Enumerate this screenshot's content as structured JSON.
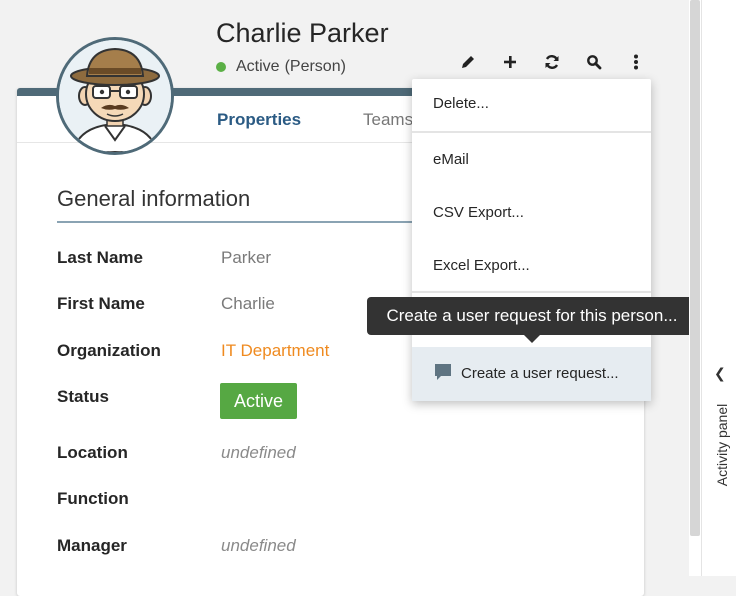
{
  "person": {
    "name": "Charlie Parker",
    "status": "Active",
    "class": "(Person)"
  },
  "toolbar": {
    "icons": [
      "pencil-icon",
      "plus-icon",
      "refresh-icon",
      "search-icon",
      "more-vertical-icon"
    ]
  },
  "tabs": [
    {
      "label": "Properties"
    },
    {
      "label": "Teams"
    }
  ],
  "section": {
    "title": "General information"
  },
  "fields": {
    "last_name": {
      "label": "Last Name",
      "value": "Parker"
    },
    "first_name": {
      "label": "First Name",
      "value": "Charlie"
    },
    "organization": {
      "label": "Organization",
      "value": "IT Department"
    },
    "status": {
      "label": "Status",
      "value": "Active"
    },
    "location": {
      "label": "Location",
      "value": "undefined"
    },
    "function": {
      "label": "Function",
      "value": ""
    },
    "manager": {
      "label": "Manager",
      "value": "undefined"
    }
  },
  "menu": {
    "delete": "Delete...",
    "email": "eMail",
    "csv_export": "CSV Export...",
    "excel_export": "Excel Export...",
    "create_request": "Create a user request..."
  },
  "tooltip": {
    "text": "Create a user request for this person..."
  },
  "activity_panel": {
    "label": "Activity panel"
  },
  "colors": {
    "accent_blue": "#2b5b84",
    "card_header": "#4f6a78",
    "status_green": "#56a843",
    "link_orange": "#ef8a1f"
  }
}
